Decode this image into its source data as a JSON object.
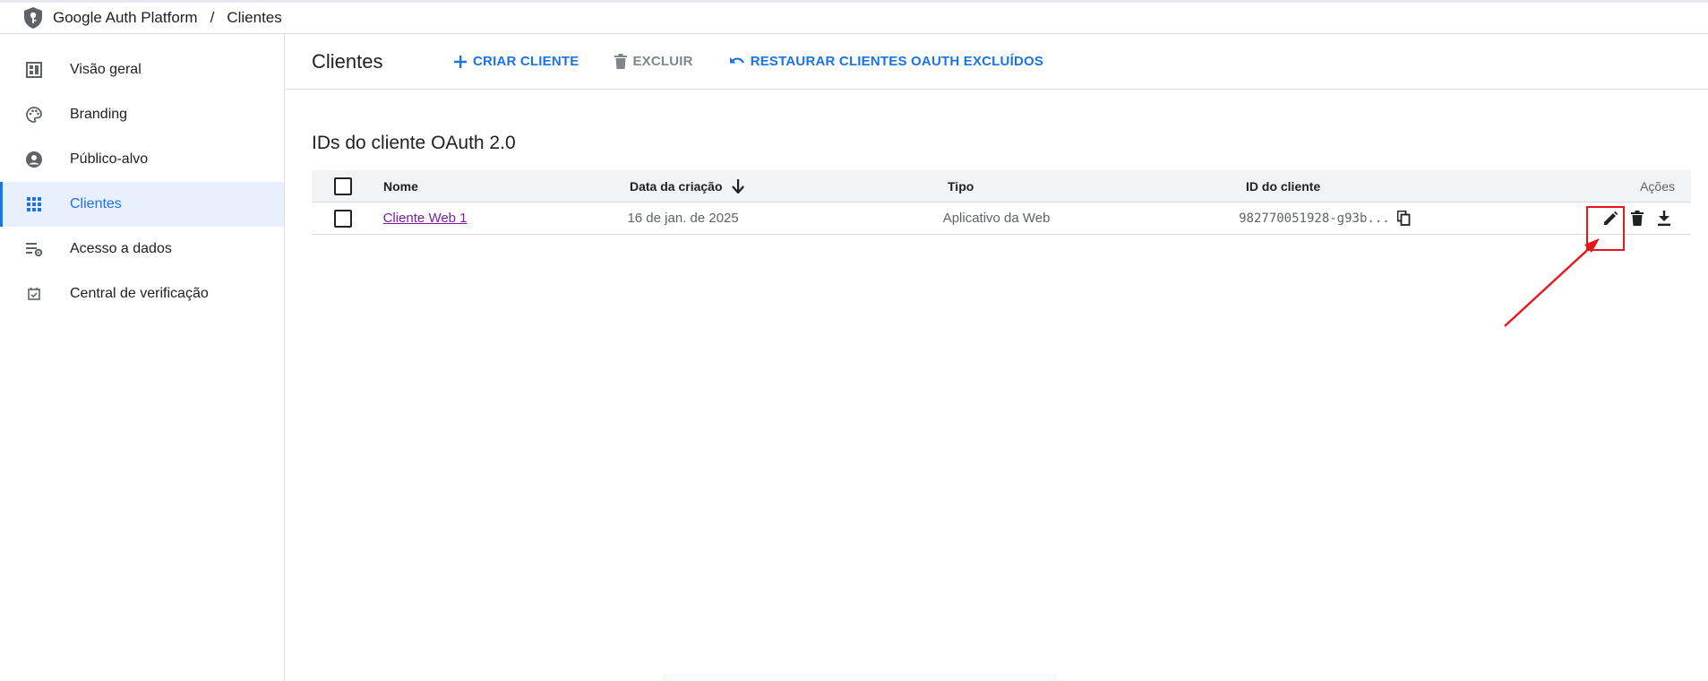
{
  "topbar": {
    "product": "Google Auth Platform",
    "separator": "/",
    "current": "Clientes"
  },
  "sidebar": {
    "items": [
      {
        "label": "Visão geral",
        "icon": "dashboard-icon",
        "active": false
      },
      {
        "label": "Branding",
        "icon": "palette-icon",
        "active": false
      },
      {
        "label": "Público-alvo",
        "icon": "account-circle-icon",
        "active": false
      },
      {
        "label": "Clientes",
        "icon": "apps-grid-icon",
        "active": true
      },
      {
        "label": "Acesso a dados",
        "icon": "list-settings-icon",
        "active": false
      },
      {
        "label": "Central de verificação",
        "icon": "checkbox-icon",
        "active": false
      }
    ]
  },
  "toolbar": {
    "title": "Clientes",
    "create_label": "CRIAR CLIENTE",
    "delete_label": "EXCLUIR",
    "restore_label": "RESTAURAR CLIENTES OAUTH EXCLUÍDOS"
  },
  "section": {
    "title": "IDs do cliente OAuth 2.0"
  },
  "table": {
    "headers": {
      "name": "Nome",
      "date": "Data da criação",
      "type": "Tipo",
      "id": "ID do cliente",
      "actions": "Ações"
    },
    "rows": [
      {
        "name": "Cliente Web 1",
        "date": "16 de jan. de 2025",
        "type": "Aplicativo da Web",
        "id": "982770051928-g93b..."
      }
    ]
  },
  "colors": {
    "accent": "#1a73e8",
    "link_visited": "#7b1fa2",
    "annotation": "#e8161a",
    "active_bg": "#e8f0fe"
  }
}
